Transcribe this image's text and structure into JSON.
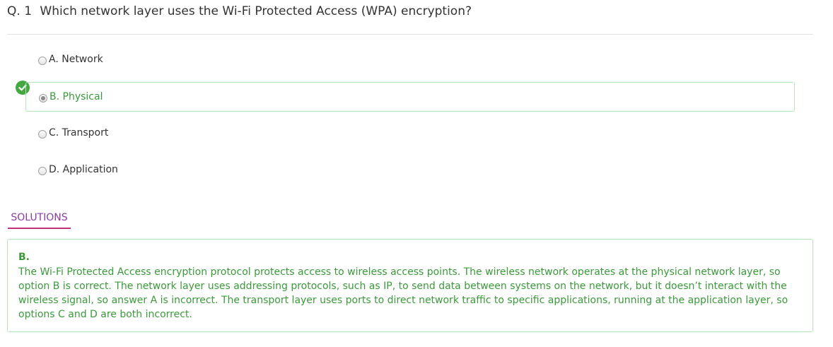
{
  "question": {
    "number": "Q. 1",
    "text": "Which network layer uses the Wi-Fi Protected Access (WPA) encryption?"
  },
  "options": [
    {
      "label": "A. Network",
      "selected": false,
      "correct": false
    },
    {
      "label": "B. Physical",
      "selected": true,
      "correct": true
    },
    {
      "label": "C. Transport",
      "selected": false,
      "correct": false
    },
    {
      "label": "D. Application",
      "selected": false,
      "correct": false
    }
  ],
  "solutions": {
    "tab_label": "SOLUTIONS",
    "answer": "B.",
    "explanation": "The Wi-Fi Protected Access encryption protocol protects access to wireless access points. The wireless network operates at the physical network layer, so option B is correct. The network layer uses addressing protocols, such as IP, to send data between systems on the network, but it doesn’t interact with the wireless signal, so answer A is incorrect. The transport layer uses ports to direct network traffic to specific applications, running at the application layer, so options C and D are both incorrect."
  },
  "colors": {
    "correct_green": "#43a843",
    "correct_text": "#3a9a3a",
    "correct_border": "#b8e6b8",
    "tab_text": "#8a3ea0",
    "tab_underline": "#c4307a"
  },
  "icons": {
    "correct_marker": "check-circle-icon"
  }
}
